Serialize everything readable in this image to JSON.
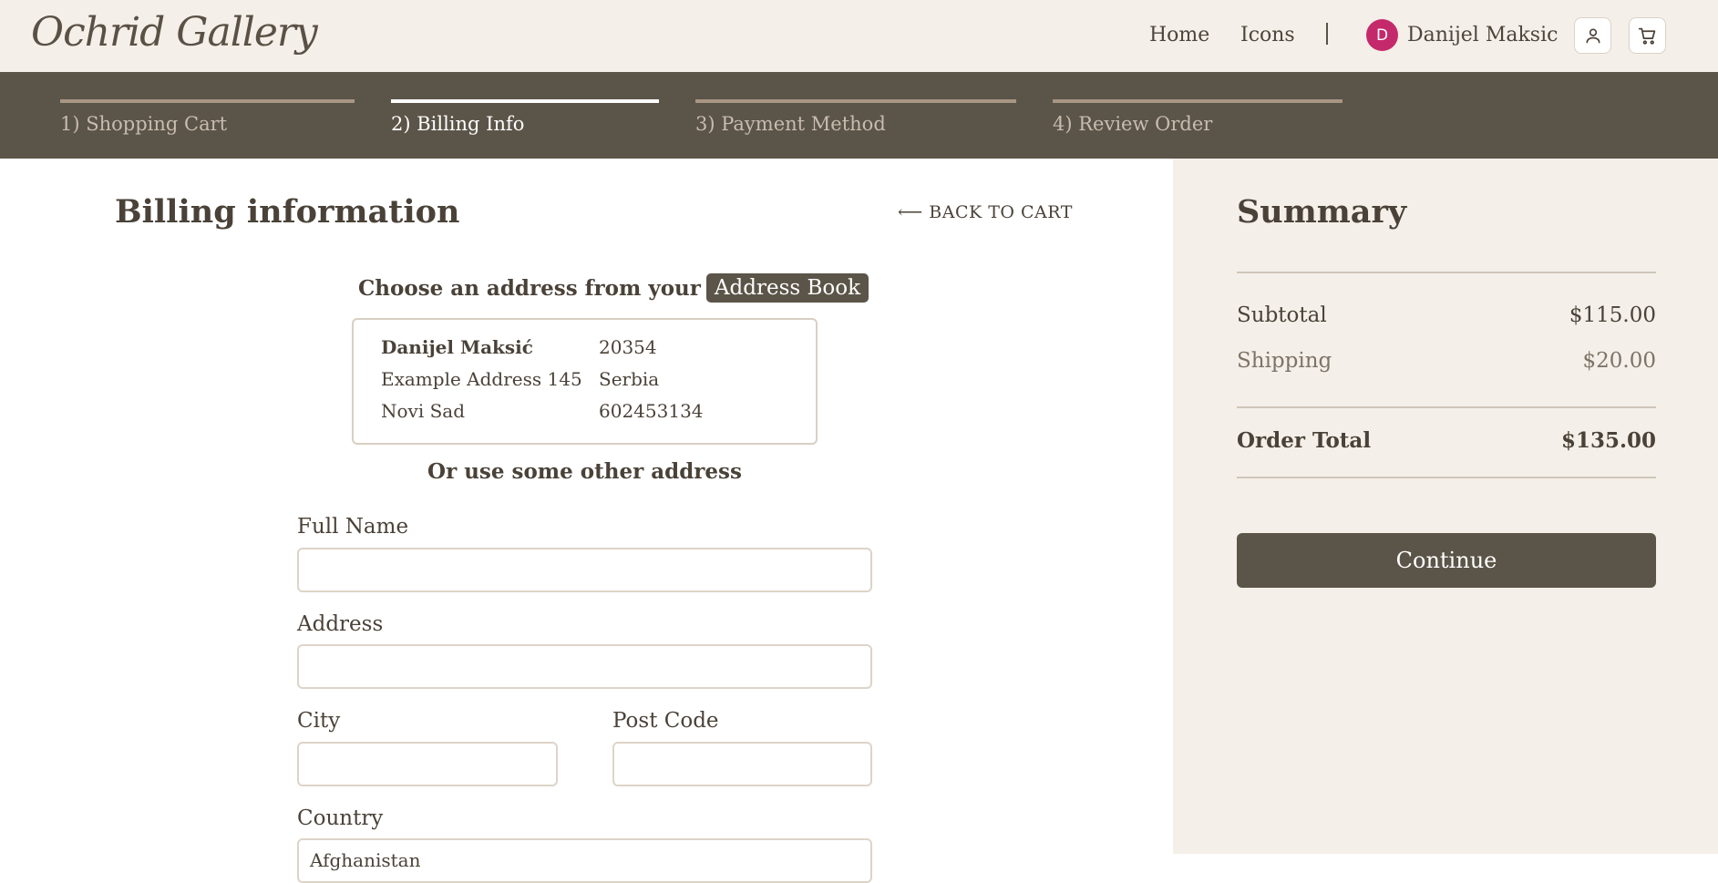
{
  "header": {
    "logo": "Ochrid Gallery",
    "nav": [
      {
        "label": "Home"
      },
      {
        "label": "Icons"
      }
    ],
    "user": {
      "initial": "D",
      "name": "Danijel Maksic",
      "avatar_color": "#c42a6b"
    },
    "icons": [
      "user-icon",
      "cart-icon"
    ]
  },
  "steps": [
    {
      "label": "1) Shopping Cart",
      "active": false
    },
    {
      "label": "2) Billing Info",
      "active": true
    },
    {
      "label": "3) Payment Method",
      "active": false
    },
    {
      "label": "4) Review Order",
      "active": false
    }
  ],
  "billing": {
    "title": "Billing information",
    "back_link": "⟵ BACK TO CART",
    "choose_text": "Choose an address from your",
    "address_book_label": "Address Book",
    "saved_address": {
      "name": "Danijel Maksić",
      "street": "Example Address 145",
      "city": "Novi Sad",
      "post_code": "20354",
      "country": "Serbia",
      "phone": "602453134"
    },
    "or_text": "Or use some other address",
    "form": {
      "full_name_label": "Full Name",
      "full_name_value": "",
      "address_label": "Address",
      "address_value": "",
      "city_label": "City",
      "city_value": "",
      "post_code_label": "Post Code",
      "post_code_value": "",
      "country_label": "Country",
      "country_value": "Afghanistan"
    }
  },
  "summary": {
    "title": "Summary",
    "subtotal_label": "Subtotal",
    "subtotal_value": "$115.00",
    "shipping_label": "Shipping",
    "shipping_value": "$20.00",
    "total_label": "Order Total",
    "total_value": "$135.00",
    "continue_label": "Continue"
  },
  "colors": {
    "header_bg": "#f4efe8",
    "steps_bg": "#5b5448",
    "accent_dark": "#5b5448",
    "text": "#4a4238"
  }
}
